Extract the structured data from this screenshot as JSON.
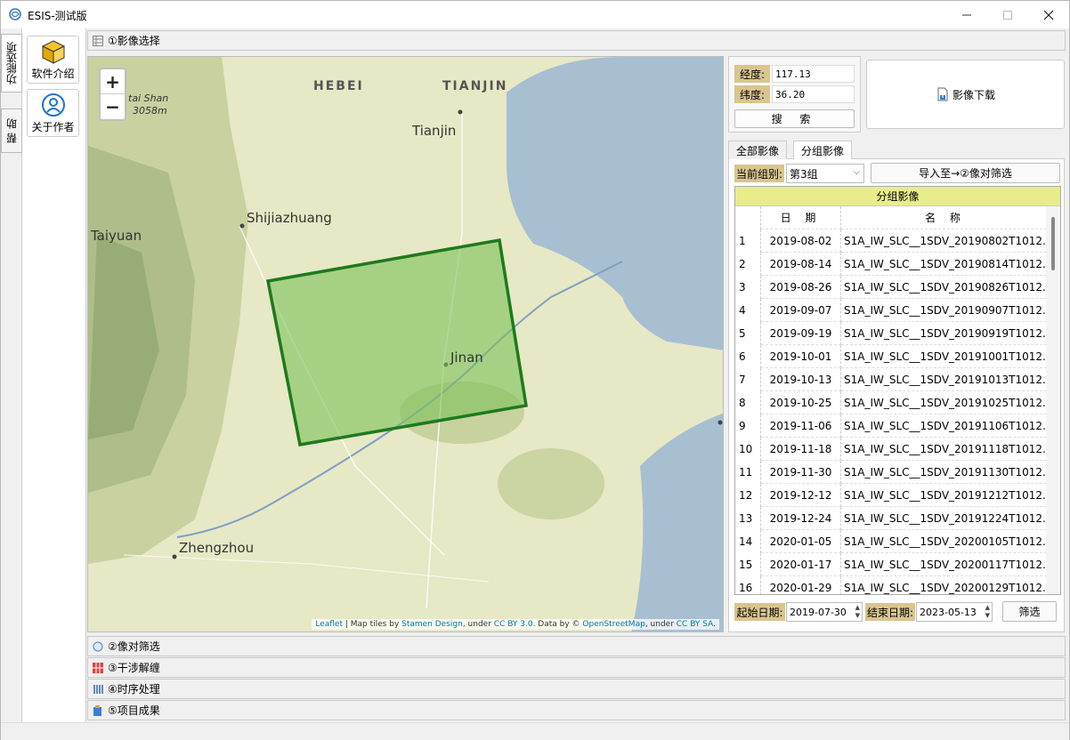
{
  "window": {
    "title": "ESIS-测试版"
  },
  "vtabs": [
    "功能选项",
    "帮 助"
  ],
  "tools": [
    {
      "label": "软件介绍",
      "icon": "box-icon"
    },
    {
      "label": "关于作者",
      "icon": "user-icon"
    }
  ],
  "sections": [
    {
      "label": "①影像选择",
      "icon": "grid-icon"
    },
    {
      "label": "②像对筛选",
      "icon": "circle-icon"
    },
    {
      "label": "③干涉解缠",
      "icon": "grid-red-icon"
    },
    {
      "label": "④时序处理",
      "icon": "bars-icon"
    },
    {
      "label": "⑤项目成果",
      "icon": "clipboard-icon"
    }
  ],
  "map": {
    "zoom_in": "+",
    "zoom_out": "−",
    "labels": [
      "HEBEI",
      "TIANJIN",
      "Tianjin",
      "Shijiazhuang",
      "Taiyuan",
      "Jinan",
      "Zhengzhou",
      "tai Shan",
      "3058m"
    ],
    "attribution": {
      "leaflet": "Leaflet",
      "sep1": " | Map tiles by ",
      "stamen": "Stamen Design",
      "sep2": ", under ",
      "ccby": "CC BY 3.0",
      "sep3": ". Data by © ",
      "osm": "OpenStreetMap",
      "sep4": ", under ",
      "ccbysa": "CC BY SA",
      "end": "."
    },
    "footprint_color": "#1e7a1e"
  },
  "coords": {
    "lon_label": "经度:",
    "lon_value": "117.13",
    "lat_label": "纬度:",
    "lat_value": "36.20",
    "search_label": "搜 索"
  },
  "download_label": "影像下载",
  "tabs": [
    "全部影像",
    "分组影像"
  ],
  "group": {
    "label": "当前组别:",
    "selected": "第3组",
    "import_label": "导入至→②像对筛选"
  },
  "table": {
    "title": "分组影像",
    "headers": [
      "日 期",
      "名 称"
    ],
    "rows": [
      [
        "1",
        "2019-08-02",
        "S1A_IW_SLC__1SDV_20190802T1012..."
      ],
      [
        "2",
        "2019-08-14",
        "S1A_IW_SLC__1SDV_20190814T1012..."
      ],
      [
        "3",
        "2019-08-26",
        "S1A_IW_SLC__1SDV_20190826T1012..."
      ],
      [
        "4",
        "2019-09-07",
        "S1A_IW_SLC__1SDV_20190907T1012..."
      ],
      [
        "5",
        "2019-09-19",
        "S1A_IW_SLC__1SDV_20190919T1012..."
      ],
      [
        "6",
        "2019-10-01",
        "S1A_IW_SLC__1SDV_20191001T1012..."
      ],
      [
        "7",
        "2019-10-13",
        "S1A_IW_SLC__1SDV_20191013T1012..."
      ],
      [
        "8",
        "2019-10-25",
        "S1A_IW_SLC__1SDV_20191025T1012..."
      ],
      [
        "9",
        "2019-11-06",
        "S1A_IW_SLC__1SDV_20191106T1012..."
      ],
      [
        "10",
        "2019-11-18",
        "S1A_IW_SLC__1SDV_20191118T1012..."
      ],
      [
        "11",
        "2019-11-30",
        "S1A_IW_SLC__1SDV_20191130T1012..."
      ],
      [
        "12",
        "2019-12-12",
        "S1A_IW_SLC__1SDV_20191212T1012..."
      ],
      [
        "13",
        "2019-12-24",
        "S1A_IW_SLC__1SDV_20191224T1012..."
      ],
      [
        "14",
        "2020-01-05",
        "S1A_IW_SLC__1SDV_20200105T1012..."
      ],
      [
        "15",
        "2020-01-17",
        "S1A_IW_SLC__1SDV_20200117T1012..."
      ],
      [
        "16",
        "2020-01-29",
        "S1A_IW_SLC__1SDV_20200129T1012..."
      ]
    ]
  },
  "filter": {
    "start_label": "起始日期:",
    "start_value": "2019-07-30",
    "end_label": "结束日期:",
    "end_value": "2023-05-13",
    "button_label": "筛选"
  }
}
